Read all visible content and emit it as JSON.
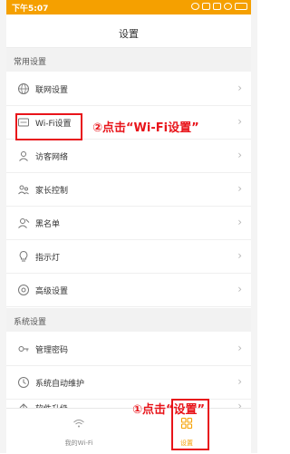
{
  "status_bar": {
    "time": "下午5:07",
    "background": "#f5a000"
  },
  "header": {
    "title": "设置"
  },
  "sections": {
    "common": {
      "title": "常用设置",
      "items": [
        {
          "label": "联网设置",
          "icon": "globe-icon"
        },
        {
          "label": "Wi-Fi设置",
          "icon": "wifi-settings-icon"
        },
        {
          "label": "访客网络",
          "icon": "guest-network-icon"
        },
        {
          "label": "家长控制",
          "icon": "parental-control-icon"
        },
        {
          "label": "黑名单",
          "icon": "blacklist-icon"
        },
        {
          "label": "指示灯",
          "icon": "indicator-light-icon"
        },
        {
          "label": "高级设置",
          "icon": "advanced-settings-icon"
        }
      ]
    },
    "system": {
      "title": "系统设置",
      "items": [
        {
          "label": "管理密码",
          "icon": "key-icon"
        },
        {
          "label": "系统自动维护",
          "icon": "auto-maintenance-icon"
        },
        {
          "label": "软件升级",
          "icon": "upgrade-icon"
        }
      ]
    }
  },
  "bottom_nav": {
    "items": [
      {
        "label": "我的Wi-Fi",
        "icon": "wifi-icon",
        "active": false
      },
      {
        "label": "设置",
        "icon": "grid-icon",
        "active": true
      }
    ]
  },
  "annotations": {
    "step2": "②点击“Wi-Fi设置”",
    "step1": "①点击“设置”",
    "highlight_color": "#e8141a"
  },
  "colors": {
    "accent": "#f5a000",
    "annotation": "#e8141a"
  }
}
